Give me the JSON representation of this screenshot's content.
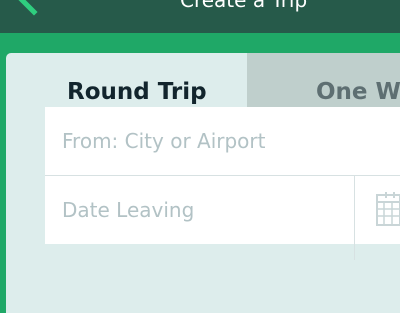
{
  "header": {
    "title": "Create a Trip",
    "back_icon": "chevron-left-icon"
  },
  "tabs": [
    {
      "label": "Round Trip",
      "selected": true
    },
    {
      "label": "One Way",
      "selected": false
    }
  ],
  "form": {
    "from_placeholder": "From: City or Airport",
    "from_value": "",
    "date_placeholder": "Date Leaving",
    "date_value": "",
    "date_icon": "calendar-icon"
  },
  "colors": {
    "header_bg": "#265a4a",
    "accent_green": "#1fa867",
    "card_bg": "#ddedec",
    "tab_inactive_bg": "#bfcfcc",
    "placeholder_text": "#b2c2c5"
  }
}
